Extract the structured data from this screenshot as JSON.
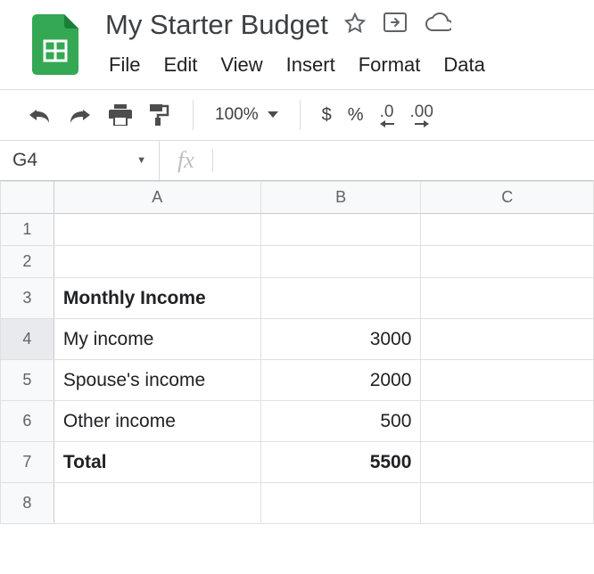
{
  "title": "My Starter Budget",
  "menu": [
    "File",
    "Edit",
    "View",
    "Insert",
    "Format",
    "Data"
  ],
  "zoom": "100%",
  "currency_symbol": "$",
  "percent_symbol": "%",
  "dec_less": ".0",
  "dec_more": ".00",
  "namebox": "G4",
  "fx_label": "fx",
  "columns": [
    "A",
    "B",
    "C"
  ],
  "row_headers": [
    "1",
    "2",
    "3",
    "4",
    "5",
    "6",
    "7",
    "8"
  ],
  "cells": {
    "A3": "Monthly Income",
    "A4": "My income",
    "B4": "3000",
    "A5": "Spouse's income",
    "B5": "2000",
    "A6": "Other income",
    "B6": "500",
    "A7": "Total",
    "B7": "5500"
  }
}
